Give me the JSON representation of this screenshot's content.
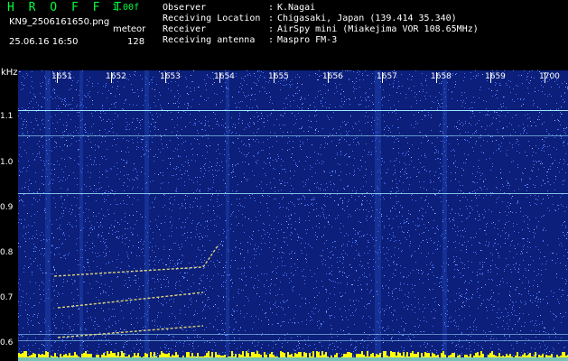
{
  "header": {
    "app_title": "H R O F F T",
    "app_version": "1.00f",
    "file_name": "KN9_2506161650.png",
    "mode_label": "meteor",
    "date_time": "25.06.16 16:50",
    "fft_size": "128",
    "info": [
      {
        "label": "Observer",
        "value": "K.Nagai"
      },
      {
        "label": "Receiving Location",
        "value": "Chigasaki, Japan (139.414 35.340)"
      },
      {
        "label": "Receiver",
        "value": "AirSpy mini (Miakejima VOR 108.65MHz)"
      },
      {
        "label": "Receiving antenna",
        "value": "Maspro FM-3"
      }
    ],
    "separator": ":"
  },
  "axes": {
    "y_unit": "kHz",
    "y_ticks": [
      "1.1",
      "1.0",
      "0.9",
      "0.8",
      "0.7",
      "0.6"
    ],
    "x_ticks": [
      "1651",
      "1652",
      "1653",
      "1654",
      "1655",
      "1656",
      "1657",
      "1658",
      "1659",
      "1700"
    ]
  },
  "colors": {
    "background": "#0c1f7a",
    "noise": "#4a78ff",
    "signal_line": "#9fe8ff",
    "echo": "#fff27a",
    "bottom_band": "#ffff00",
    "text_green": "#00ff3c"
  }
}
